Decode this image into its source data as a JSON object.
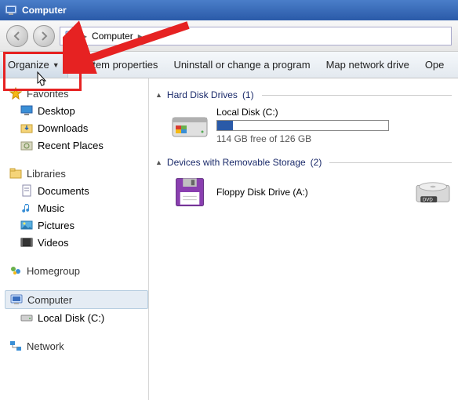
{
  "title": "Computer",
  "address": {
    "root": "Computer"
  },
  "toolbar": {
    "organize": "Organize",
    "sysprops": "System properties",
    "uninstall": "Uninstall or change a program",
    "mapdrive": "Map network drive",
    "open_truncated": "Ope"
  },
  "side": {
    "favorites": "Favorites",
    "desktop": "Desktop",
    "downloads": "Downloads",
    "recent": "Recent Places",
    "libraries": "Libraries",
    "documents": "Documents",
    "music": "Music",
    "pictures": "Pictures",
    "videos": "Videos",
    "homegroup": "Homegroup",
    "computer": "Computer",
    "localdisk": "Local Disk (C:)",
    "network": "Network"
  },
  "groups": {
    "hdd": {
      "label": "Hard Disk Drives",
      "count": "(1)"
    },
    "removable": {
      "label": "Devices with Removable Storage",
      "count": "(2)"
    }
  },
  "local_disk": {
    "name": "Local Disk (C:)",
    "free": "114 GB free of 126 GB",
    "used_pct": 9
  },
  "floppy": "Floppy Disk Drive (A:)",
  "dvd": "DVD"
}
